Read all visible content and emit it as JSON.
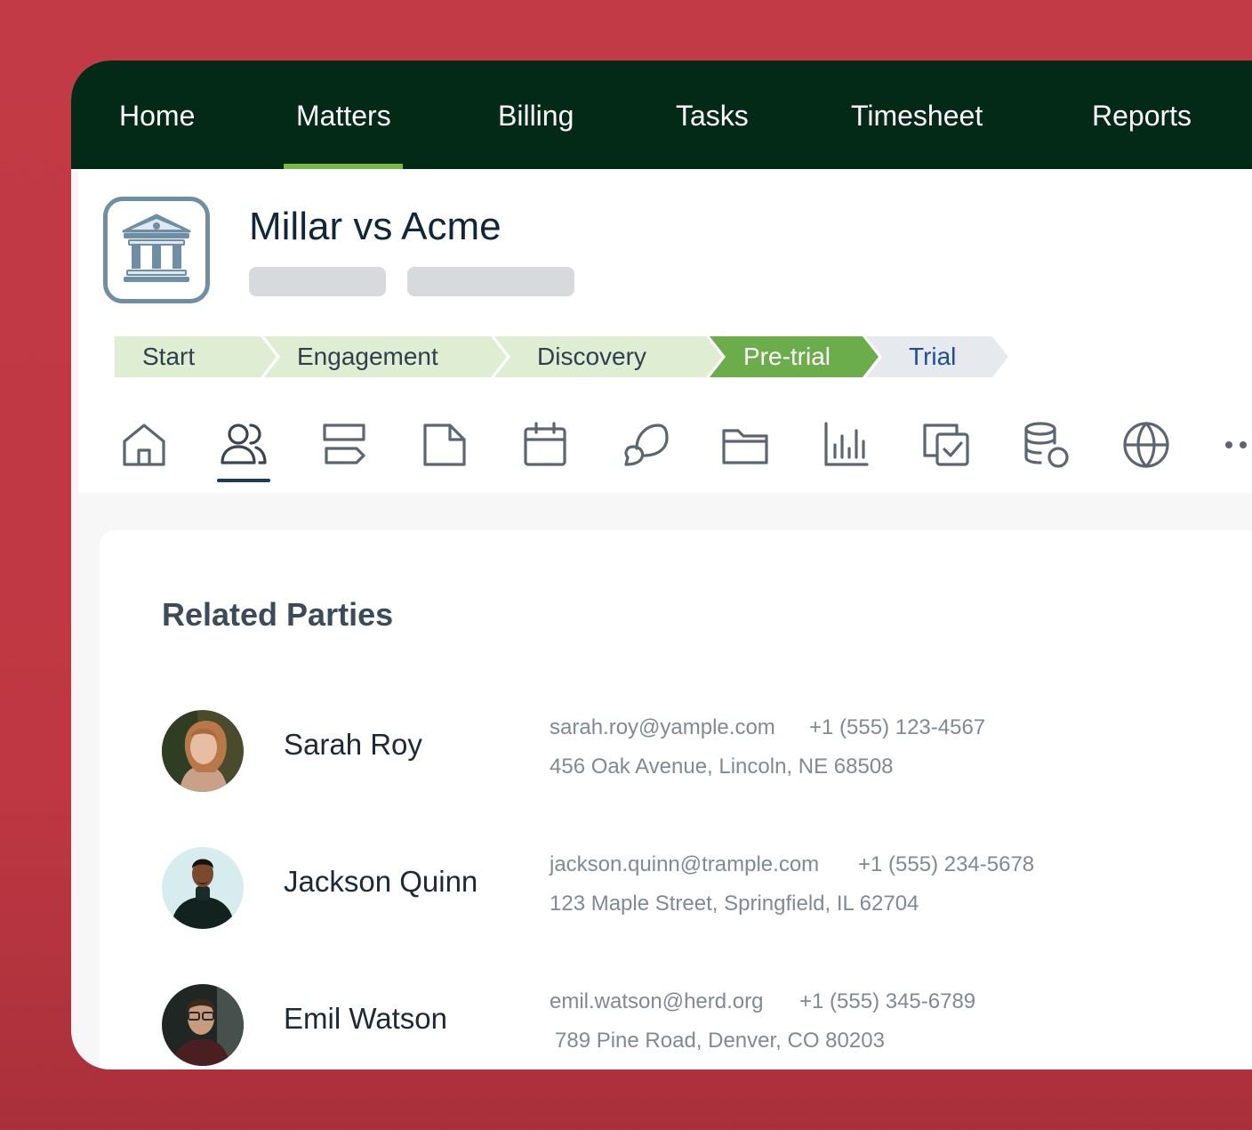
{
  "nav": {
    "items": [
      {
        "label": "Home"
      },
      {
        "label": "Matters"
      },
      {
        "label": "Billing"
      },
      {
        "label": "Tasks"
      },
      {
        "label": "Timesheet"
      },
      {
        "label": "Reports"
      }
    ],
    "active": "Matters",
    "accent_color": "#7ab648",
    "background_color": "#032a17"
  },
  "matter": {
    "title": "Millar vs Acme",
    "icon": "courthouse-icon"
  },
  "stages": {
    "items": [
      {
        "label": "Start",
        "state": "done"
      },
      {
        "label": "Engagement",
        "state": "done"
      },
      {
        "label": "Discovery",
        "state": "done"
      },
      {
        "label": "Pre-trial",
        "state": "current"
      },
      {
        "label": "Trial",
        "state": "upcoming"
      }
    ],
    "done_color": "#dfeed3",
    "current_color": "#6aad4a",
    "upcoming_color": "#e6eaee"
  },
  "toolbar": {
    "icons": [
      "home-icon",
      "people-icon",
      "signpost-icon",
      "document-icon",
      "calendar-icon",
      "chat-icon",
      "folder-icon",
      "bar-chart-icon",
      "copy-check-icon",
      "coins-icon",
      "globe-icon",
      "more-icon"
    ],
    "active": "people-icon"
  },
  "related_parties": {
    "title": "Related Parties",
    "parties": [
      {
        "name": "Sarah Roy",
        "email": "sarah.roy@yample.com",
        "phone": "+1 (555) 123-4567",
        "address": "456 Oak Avenue, Lincoln, NE 68508"
      },
      {
        "name": "Jackson Quinn",
        "email": "jackson.quinn@trample.com",
        "phone": "+1 (555) 234-5678",
        "address": "123 Maple Street, Springfield, IL 62704"
      },
      {
        "name": "Emil Watson",
        "email": "emil.watson@herd.org",
        "phone": "+1 (555) 345-6789",
        "address": "789 Pine Road, Denver, CO 80203"
      }
    ]
  }
}
